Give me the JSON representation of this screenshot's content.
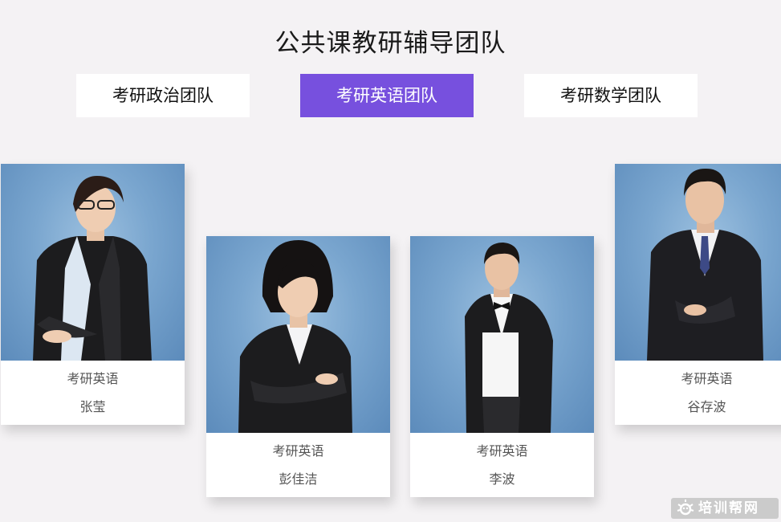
{
  "page": {
    "title": "公共课教研辅导团队"
  },
  "tabs": [
    {
      "label": "考研政治团队",
      "active": false
    },
    {
      "label": "考研英语团队",
      "active": true
    },
    {
      "label": "考研数学团队",
      "active": false
    }
  ],
  "teachers": [
    {
      "role": "考研英语",
      "name": "张莹"
    },
    {
      "role": "考研英语",
      "name": "彭佳洁"
    },
    {
      "role": "考研英语",
      "name": "李波"
    },
    {
      "role": "考研英语",
      "name": "谷存波"
    }
  ],
  "watermark": {
    "text": "培训帮网"
  },
  "colors": {
    "accent": "#7750de",
    "background": "#f4f2f4",
    "photo_bg": "#7aa6cf"
  }
}
